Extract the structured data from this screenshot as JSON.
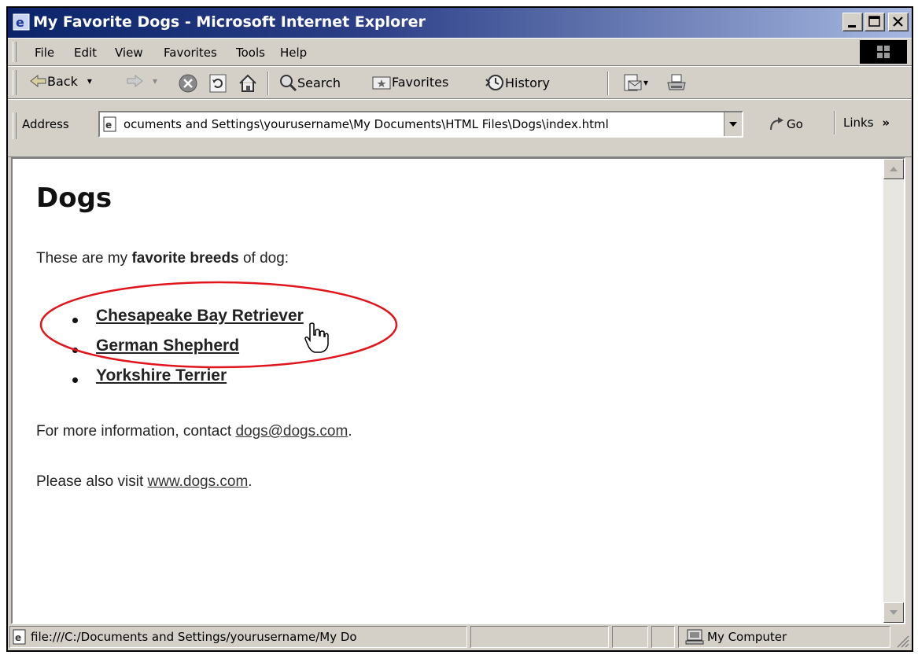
{
  "window": {
    "title": "My Favorite Dogs - Microsoft Internet Explorer"
  },
  "menu": {
    "items": [
      "File",
      "Edit",
      "View",
      "Favorites",
      "Tools",
      "Help"
    ]
  },
  "toolbar": {
    "back_label": "Back",
    "search_label": "Search",
    "favorites_label": "Favorites",
    "history_label": "History"
  },
  "address": {
    "label": "Address",
    "value": "ocuments and Settings\\yourusername\\My Documents\\HTML Files\\Dogs\\index.html",
    "go_label": "Go",
    "links_label": "Links"
  },
  "page": {
    "heading": "Dogs",
    "intro_before": "These are my ",
    "intro_bold": "favorite breeds",
    "intro_after": " of dog:",
    "breeds": [
      "Chesapeake Bay Retriever",
      "German Shepherd",
      "Yorkshire Terrier"
    ],
    "contact_before": "For more information, contact ",
    "contact_link": "dogs@dogs.com",
    "contact_after": ".",
    "visit_before": "Please also visit ",
    "visit_link": "www.dogs.com",
    "visit_after": "."
  },
  "status": {
    "url": "file:///C:/Documents and Settings/yourusername/My Do",
    "zone": "My Computer"
  },
  "colors": {
    "annotation": "#e0161d",
    "titlebar": "#0a246a"
  }
}
